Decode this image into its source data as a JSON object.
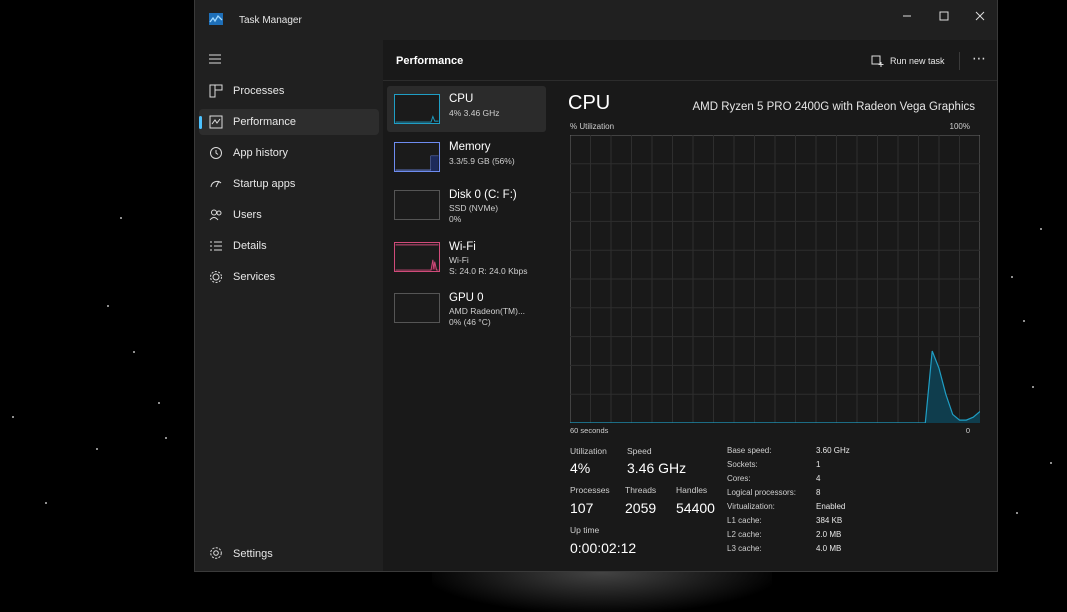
{
  "window": {
    "title": "Task Manager"
  },
  "nav": {
    "items": [
      {
        "label": "Processes",
        "icon": "processes-icon"
      },
      {
        "label": "Performance",
        "icon": "performance-icon"
      },
      {
        "label": "App history",
        "icon": "app-history-icon"
      },
      {
        "label": "Startup apps",
        "icon": "startup-apps-icon"
      },
      {
        "label": "Users",
        "icon": "users-icon"
      },
      {
        "label": "Details",
        "icon": "details-icon"
      },
      {
        "label": "Services",
        "icon": "services-icon"
      }
    ],
    "active_index": 1,
    "settings_label": "Settings"
  },
  "header": {
    "title": "Performance",
    "run_new_task": "Run new task"
  },
  "resources": [
    {
      "name": "CPU",
      "line1": "4% 3.46 GHz",
      "line2": ""
    },
    {
      "name": "Memory",
      "line1": "3.3/5.9 GB (56%)",
      "line2": ""
    },
    {
      "name": "Disk 0 (C: F:)",
      "line1": "SSD (NVMe)",
      "line2": "0%"
    },
    {
      "name": "Wi-Fi",
      "line1": "Wi-Fi",
      "line2": "S: 24.0 R: 24.0 Kbps"
    },
    {
      "name": "GPU 0",
      "line1": "AMD Radeon(TM)...",
      "line2": "0% (46 °C)"
    }
  ],
  "cpu": {
    "title": "CPU",
    "model": "AMD Ryzen 5 PRO 2400G with Radeon Vega Graphics",
    "util_label": "% Utilization",
    "util_max": "100%",
    "axis_left": "60 seconds",
    "axis_right": "0",
    "stats": {
      "utilization_label": "Utilization",
      "utilization": "4%",
      "speed_label": "Speed",
      "speed": "3.46 GHz",
      "processes_label": "Processes",
      "processes": "107",
      "threads_label": "Threads",
      "threads": "2059",
      "handles_label": "Handles",
      "handles": "54400",
      "uptime_label": "Up time",
      "uptime": "0:00:02:12"
    },
    "specs": [
      {
        "key": "Base speed:",
        "value": "3.60 GHz"
      },
      {
        "key": "Sockets:",
        "value": "1"
      },
      {
        "key": "Cores:",
        "value": "4"
      },
      {
        "key": "Logical processors:",
        "value": "8"
      },
      {
        "key": "Virtualization:",
        "value": "Enabled"
      },
      {
        "key": "L1 cache:",
        "value": "384 KB"
      },
      {
        "key": "L2 cache:",
        "value": "2.0 MB"
      },
      {
        "key": "L3 cache:",
        "value": "4.0 MB"
      }
    ]
  },
  "chart_data": {
    "type": "area",
    "x": [
      60,
      58,
      56,
      54,
      52,
      50,
      48,
      46,
      44,
      42,
      40,
      38,
      36,
      34,
      32,
      30,
      28,
      26,
      24,
      22,
      20,
      18,
      16,
      14,
      12,
      10,
      8,
      7,
      6,
      5,
      4,
      3,
      2,
      1,
      0
    ],
    "values": [
      0,
      0,
      0,
      0,
      0,
      0,
      0,
      0,
      0,
      0,
      0,
      0,
      0,
      0,
      0,
      0,
      0,
      0,
      0,
      0,
      0,
      0,
      0,
      0,
      0,
      0,
      0,
      25,
      19,
      10,
      3,
      1,
      1,
      2,
      4
    ],
    "ylim": [
      0,
      100
    ],
    "xlabel": "60 seconds",
    "ylabel": "% Utilization",
    "line_color": "#1f9ec4",
    "fill_color": "#0f3d4d",
    "grid": true
  },
  "colors": {
    "accent": "#4cc2ff",
    "cpu": "#1f9ec4",
    "memory": "#6e8cf0",
    "wifi": "#d04b7a"
  }
}
